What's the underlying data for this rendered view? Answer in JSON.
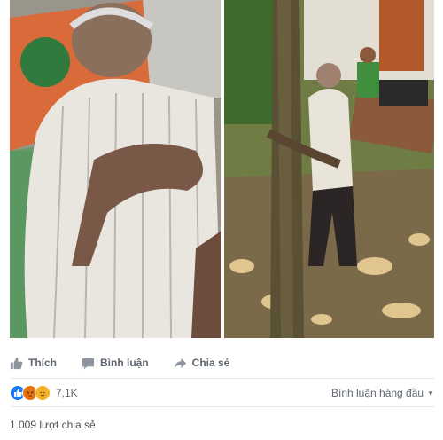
{
  "photos": {
    "left_alt_icon": "photo-elderly-man-lying",
    "right_alt_icon": "photo-elderly-man-tied-to-tree"
  },
  "actions": {
    "like_label": "Thích",
    "comment_label": "Bình luận",
    "share_label": "Chia sẻ"
  },
  "reactions": {
    "icons": [
      "like-icon",
      "angry-icon",
      "sad-icon"
    ],
    "count": "7,1K"
  },
  "comments_sort": {
    "label": "Bình luận hàng đầu"
  },
  "shares": {
    "label": "1.009 lượt chia sẻ"
  },
  "colors": {
    "like": "#1877f2",
    "angry": "#e9710f",
    "sad": "#f7b125",
    "muted_text": "#606770"
  }
}
